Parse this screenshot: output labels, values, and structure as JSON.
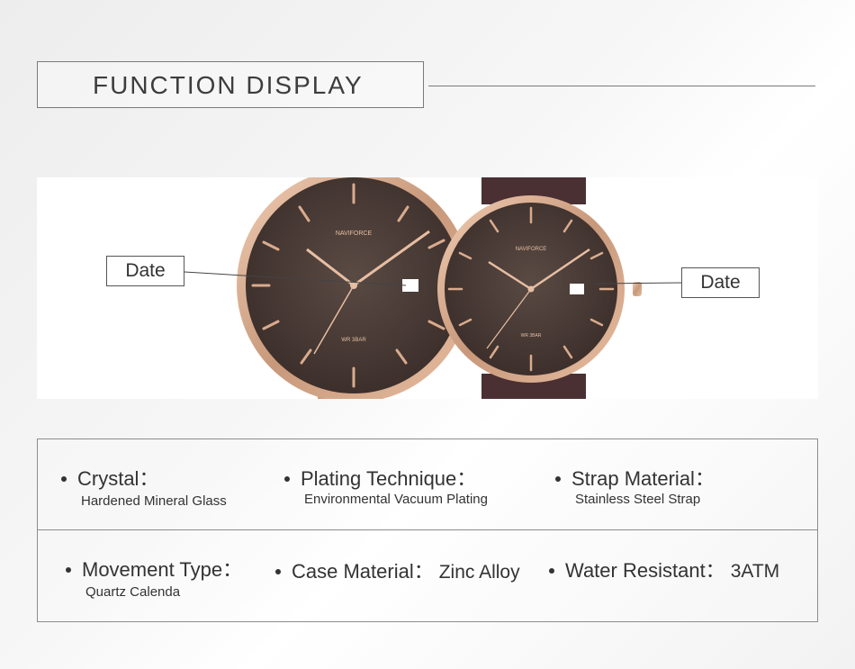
{
  "header": {
    "title": "FUNCTION  DISPLAY"
  },
  "photo": {
    "brand_text": "NAVIFORCE",
    "dial_text": "WR 3BAR",
    "callout_left": "Date",
    "callout_right": "Date",
    "colors": {
      "dial": "#4a3b36",
      "case": "#d6a98a",
      "strap": "#4a3033"
    }
  },
  "specs": {
    "crystal": {
      "label": "Crystal：",
      "detail": "Hardened Mineral Glass"
    },
    "plating": {
      "label": "Plating Technique：",
      "detail": "Environmental Vacuum Plating"
    },
    "strap": {
      "label": "Strap Material：",
      "detail": "Stainless Steel Strap"
    },
    "movement": {
      "label": "Movement Type：",
      "detail": "Quartz Calenda"
    },
    "case": {
      "label": "Case Material：",
      "value": "Zinc Alloy"
    },
    "water": {
      "label": "Water Resistant：",
      "value": "3ATM"
    }
  }
}
